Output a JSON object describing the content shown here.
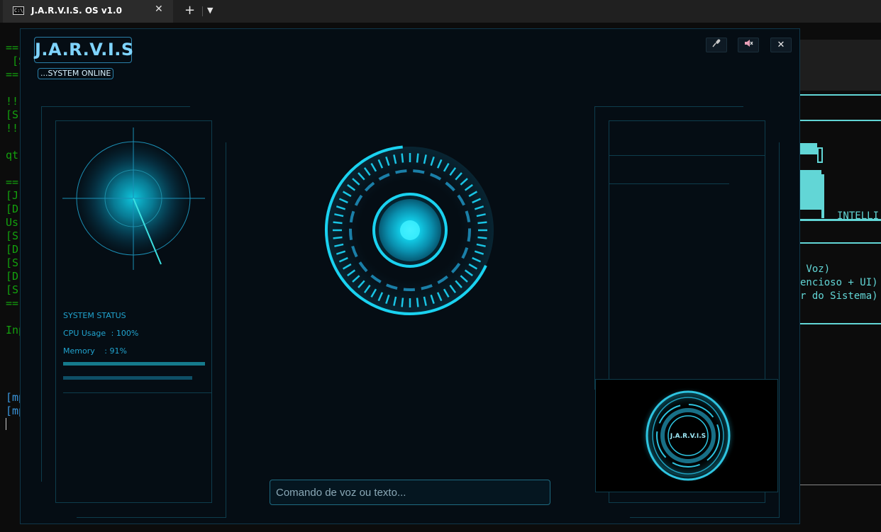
{
  "tab": {
    "title": "J.A.R.V.I.S. OS v1.0",
    "icon": "terminal-icon",
    "close": "✕",
    "new_tab": "+",
    "dropdown": "⌄"
  },
  "terminal": {
    "lines": [
      {
        "text": "==",
        "color": "green"
      },
      {
        "text": " [S",
        "color": "green"
      },
      {
        "text": "==",
        "color": "green"
      },
      {
        "text": "!!",
        "color": "green"
      },
      {
        "text": "[S",
        "color": "green"
      },
      {
        "text": "!!",
        "color": "green"
      },
      {
        "text": "qt",
        "color": "green"
      },
      {
        "text": "==",
        "color": "green"
      },
      {
        "text": "[J",
        "color": "green"
      },
      {
        "text": "[D",
        "color": "green"
      },
      {
        "text": "Us",
        "color": "green"
      },
      {
        "text": "[S",
        "color": "green"
      },
      {
        "text": "[D",
        "color": "green"
      },
      {
        "text": "[S",
        "color": "green"
      },
      {
        "text": "[D",
        "color": "green"
      },
      {
        "text": "[S",
        "color": "green"
      },
      {
        "text": "==",
        "color": "green"
      },
      {
        "text": "Inp",
        "color": "green"
      },
      {
        "text": "[mp",
        "color": "blue"
      },
      {
        "text": "[mp",
        "color": "blue"
      }
    ],
    "right": {
      "intelli": "INTELLI",
      "line1": " Voz)",
      "line2": "encioso + UI)",
      "line3": "r do Sistema)"
    }
  },
  "jarvis": {
    "logo": "J.A.R.V.I.S",
    "status_chip": "...SYSTEM ONLINE",
    "window_buttons": [
      {
        "name": "mic-button",
        "icon": "microphone-icon",
        "glyph": "🎤"
      },
      {
        "name": "sound-button",
        "icon": "speaker-icon",
        "glyph": "🔇"
      },
      {
        "name": "close-button",
        "icon": "close-icon",
        "glyph": "✕"
      }
    ],
    "system_status": {
      "title": "SYSTEM STATUS",
      "cpu_label": "CPU Usage",
      "cpu_value": ": 100%",
      "memory_label": "Memory",
      "memory_value": ": 91%",
      "cpu_percent": 100,
      "memory_percent": 91
    },
    "command_placeholder": "Comando de voz ou texto...",
    "video_logo": "J.A.R.V.I.S",
    "colors": {
      "accent": "#21a4cf",
      "core": "#19d5f5",
      "logo": "#7fd4ff"
    }
  }
}
